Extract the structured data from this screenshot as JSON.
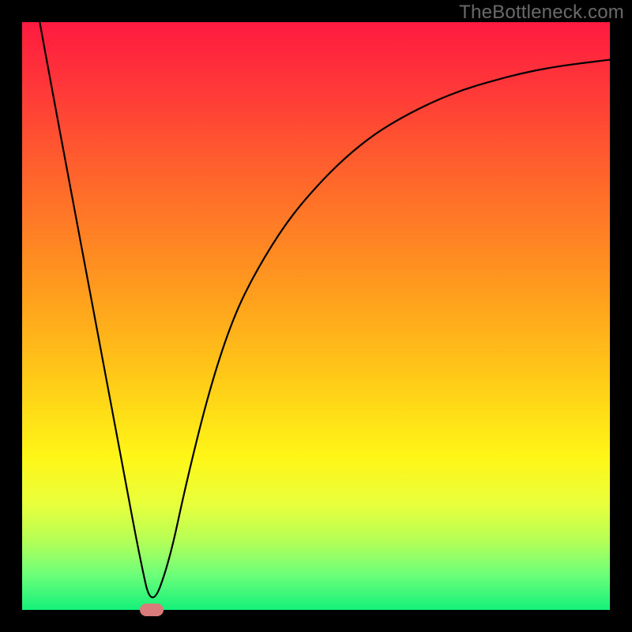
{
  "watermark": "TheBottleneck.com",
  "chart_data": {
    "type": "line",
    "title": "",
    "xlabel": "",
    "ylabel": "",
    "xlim": [
      0,
      100
    ],
    "ylim": [
      0,
      100
    ],
    "grid": false,
    "legend": false,
    "background_gradient": {
      "top": "#ff1a40",
      "middle": "#ffd020",
      "bottom": "#14f07a"
    },
    "series": [
      {
        "name": "bottleneck-curve",
        "x": [
          3,
          5,
          8,
          11,
          14,
          17,
          20,
          22,
          25,
          28,
          32,
          36,
          40,
          45,
          50,
          55,
          60,
          65,
          70,
          75,
          80,
          85,
          90,
          95,
          100
        ],
        "y": [
          100,
          89,
          73,
          57,
          41,
          25,
          9,
          0,
          8,
          22,
          38,
          50,
          58,
          66,
          72,
          77,
          81,
          84,
          86.5,
          88.5,
          90,
          91.3,
          92.3,
          93,
          93.6
        ]
      }
    ],
    "marker": {
      "name": "optimal-point",
      "x": 22,
      "y": 0,
      "color": "#d97b7b"
    }
  }
}
